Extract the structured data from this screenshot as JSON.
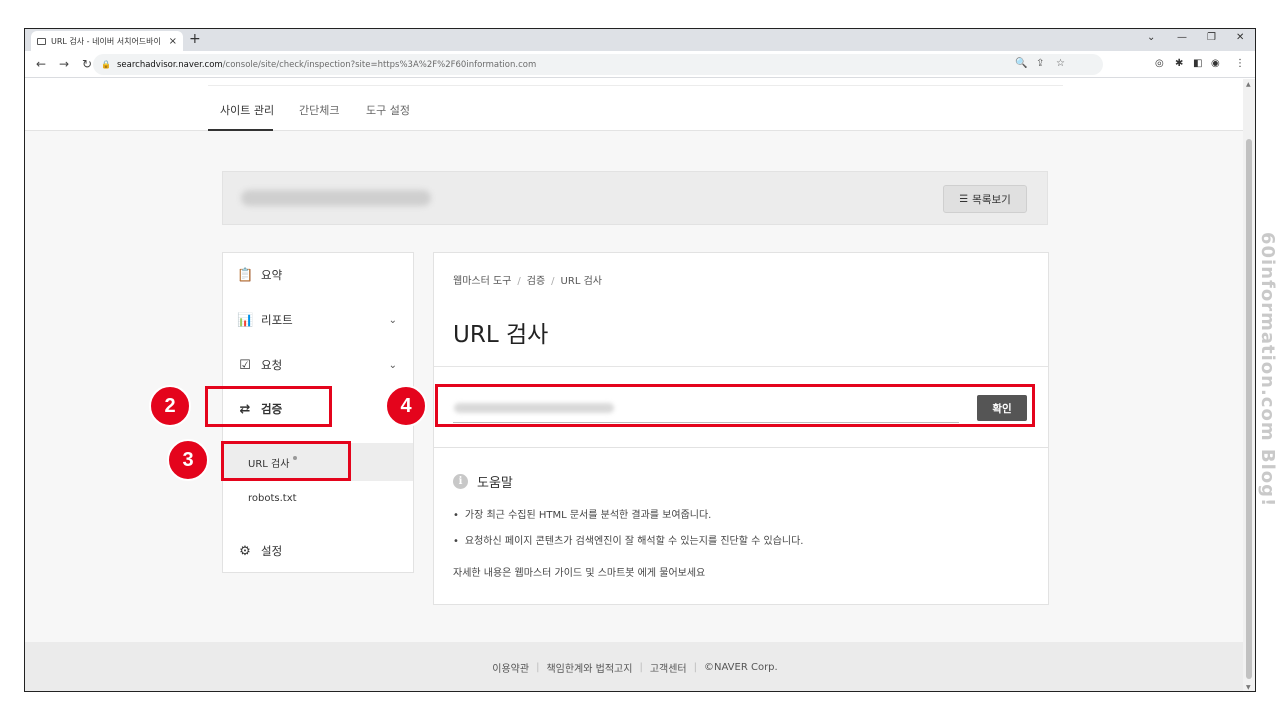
{
  "browser": {
    "tab_title": "URL 검사 - 네이버 서치어드바이",
    "new_tab": "+",
    "tab_close": "×",
    "url_host": "searchadvisor.naver.com",
    "url_path": "/console/site/check/inspection?site=https%3A%2F%2F60information.com"
  },
  "topnav": {
    "tabs": [
      "사이트 관리",
      "간단체크",
      "도구 설정"
    ]
  },
  "sitebar": {
    "list_button": "목록보기"
  },
  "sidemenu": {
    "items": [
      "요약",
      "리포트",
      "요청",
      "검증"
    ],
    "subitems": [
      "URL 검사",
      "robots.txt"
    ],
    "settings": "설정"
  },
  "main": {
    "breadcrumb": [
      "웹마스터 도구",
      "검증",
      "URL 검사"
    ],
    "title": "URL 검사",
    "confirm_button": "확인"
  },
  "help": {
    "title": "도움말",
    "bullets": [
      "가장 최근 수집된 HTML 문서를 분석한 결과를 보여줍니다.",
      "요청하신 페이지 콘텐츠가 검색엔진이 잘 해석할 수 있는지를 진단할 수 있습니다."
    ],
    "note": "자세한 내용은 웹마스터 가이드 및 스마트봇 에게 물어보세요"
  },
  "footer": {
    "links": [
      "이용약관",
      "책임한계와 법적고지",
      "고객센터",
      "©NAVER Corp."
    ]
  },
  "annotations": [
    "2",
    "3",
    "4"
  ],
  "watermark": "60information.com Blog!",
  "colors": {
    "annotation_red": "#e4041c",
    "confirm_button_bg": "#555555"
  }
}
